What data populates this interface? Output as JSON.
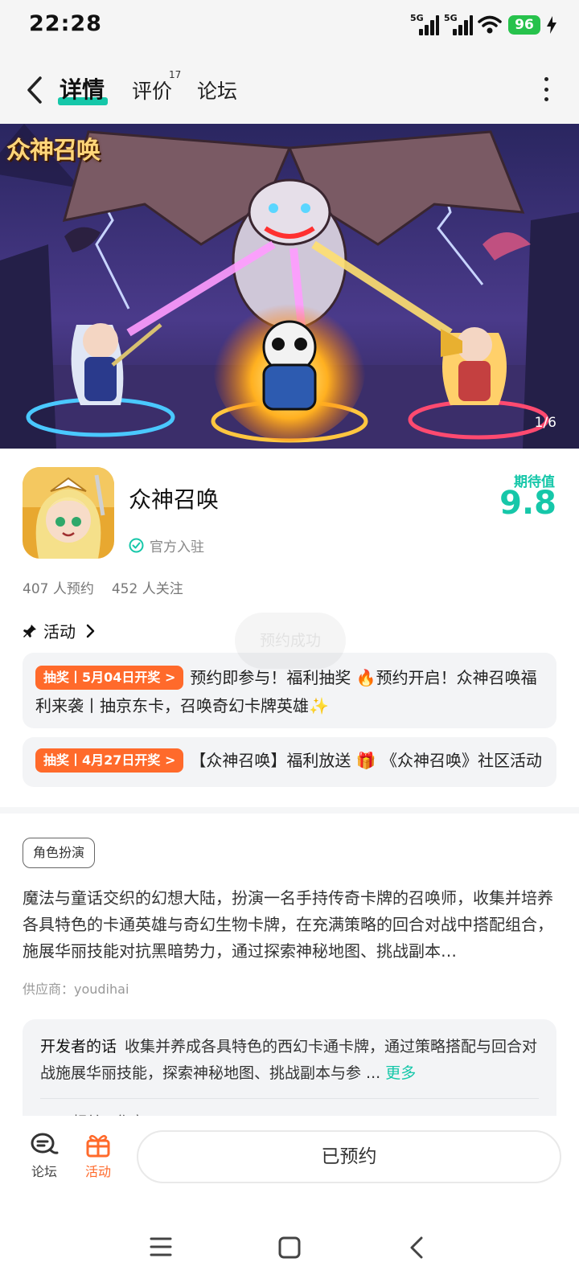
{
  "status_bar": {
    "time": "22:28",
    "network_1": "5G",
    "network_2": "5G",
    "battery": "96",
    "icons": [
      "signal-icon",
      "signal-icon",
      "wifi-icon",
      "battery-icon",
      "charging-icon"
    ]
  },
  "nav": {
    "tabs": [
      {
        "label": "详情",
        "active": true
      },
      {
        "label": "评价",
        "badge": "17"
      },
      {
        "label": "论坛"
      }
    ],
    "accent": "#16c7a9"
  },
  "banner": {
    "logo_text": "众神召唤",
    "page_indicator": "1/6"
  },
  "app": {
    "name": "众神召唤",
    "official": "官方入驻",
    "expect_label": "期待值",
    "expect_score": "9.8",
    "reservations": "407 人预约",
    "followers": "452 人关注"
  },
  "activity": {
    "title": "活动",
    "toast": "预约成功",
    "items": [
      {
        "tag": "抽奖丨5月04日开奖 >",
        "text": "预约即参与！福利抽奖 🔥预约开启！众神召唤福利来袭丨抽京东卡，召唤奇幻卡牌英雄✨"
      },
      {
        "tag": "抽奖丨4月27日开奖 >",
        "text": "【众神召唤】福利放送 🎁 《众神召唤》社区活动"
      }
    ],
    "tag_color": "#ff6a2b"
  },
  "details": {
    "genre": "角色扮演",
    "description": "魔法与童话交织的幻想大陆，扮演一名手持传奇卡牌的召唤师，收集并培养各具特色的卡通英雄与奇幻生物卡牌，在充满策略的回合对战中搭配组合，施展华丽技能对抗黑暗势力，通过探索神秘地图、挑战副本…",
    "vendor": "供应商：youdihai"
  },
  "developer": {
    "label": "开发者的话",
    "text": "收集并养成各具特色的西幻卡通卡牌，通过策略搭配与回合对战施展华丽技能，探索神秘地图、挑战副本与参 ...",
    "more": "更多",
    "partial": "相关工作室"
  },
  "bottom_bar": {
    "forum_label": "论坛",
    "activity_label": "活动",
    "reserved_label": "已预约"
  },
  "system_nav": [
    "menu-icon",
    "home-icon",
    "back-icon"
  ]
}
